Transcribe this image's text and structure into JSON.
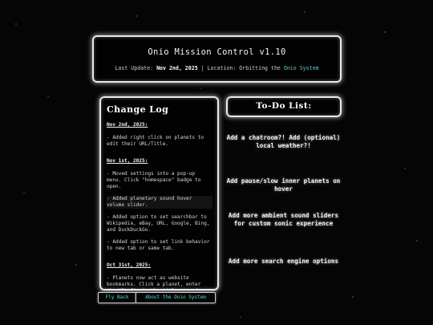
{
  "header": {
    "title": "Onio Mission Control v1.10",
    "last_update_label": "Last Update: ",
    "last_update_value": "Nov 2nd, 2025",
    "separator": " | Location: Orbitting the ",
    "location_link": "Onio System",
    "link_color": "#55d6d0"
  },
  "changelog": {
    "title": "Change Log",
    "sections": [
      {
        "date": "Nov 2nd, 2025:",
        "entries": [
          "- Added right click on planets to edit their URL/Title."
        ]
      },
      {
        "date": "Nov 1st, 2025:",
        "entries": [
          "- Moved settings into a pop-up menu. Click \"homespace\" badge to open.",
          "- Added planetary sound hover volume slider.",
          "- Added option to set searchbar to Wikipedia, eBay, URL, Google, Bing, and DuckDuckGo.",
          "- Added option to set link behavior to new tab or same tab."
        ]
      },
      {
        "date": "Oct 31st, 2025:",
        "entries": [
          "- Planets now act as website bookmarks. Click a planet, enter the URL first, the title second, press enter. You've now saved a planetary bookmark! Click to"
        ]
      }
    ]
  },
  "todo": {
    "title": "To-Do List:",
    "items": [
      "Add a chatroom?! Add (optional) local weather?!",
      "Add pause/slow inner planets on hover",
      "Add more ambient sound sliders for custom sonic experience",
      "Add more search engine options"
    ]
  },
  "buttons": {
    "fly_back": "Fly Back",
    "about": "About the Onio System"
  }
}
